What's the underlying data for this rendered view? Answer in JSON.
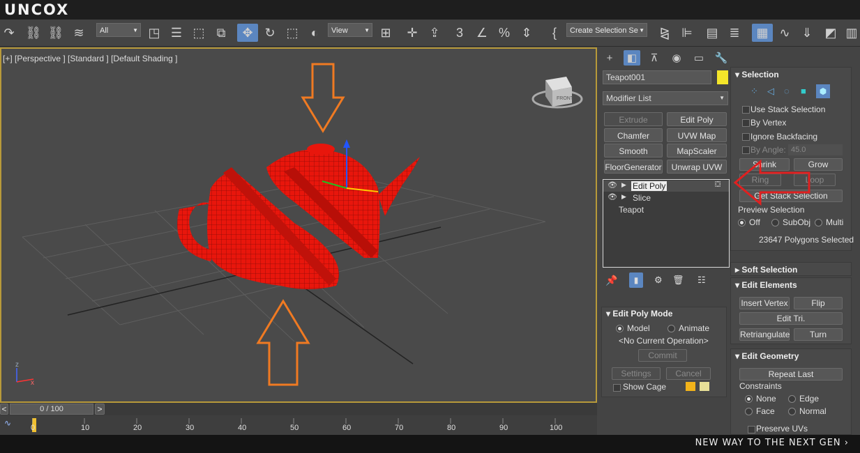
{
  "brand": "UNCOX",
  "slogan": "NEW WAY TO THE NEXT GEN ›",
  "toolbar": {
    "filter_value": "All",
    "coord_value": "View",
    "selection_set_placeholder": "Create Selection Se"
  },
  "viewport": {
    "label": "[+] [Perspective ] [Standard ] [Default Shading ]",
    "viewcube_face": "FRONT",
    "axis_x": "x",
    "axis_z": "z"
  },
  "timeline": {
    "frame_readout": "0 / 100",
    "prev": "<",
    "next": ">",
    "ticks": [
      "0",
      "10",
      "20",
      "30",
      "40",
      "50",
      "60",
      "70",
      "80",
      "90",
      "100"
    ]
  },
  "panel": {
    "object_name": "Teapot001",
    "object_color": "#f5e62a",
    "modifier_list": "Modifier List",
    "buttons": [
      "Extrude",
      "Edit Poly",
      "Chamfer",
      "UVW Map",
      "Smooth",
      "MapScaler",
      "FloorGenerator",
      "Unwrap UVW"
    ],
    "stack": [
      "Edit Poly",
      "Slice",
      "Teapot"
    ],
    "edit_poly_mode": {
      "title": "Edit Poly Mode",
      "model": "Model",
      "animate": "Animate",
      "current_op": "<No Current Operation>",
      "commit": "Commit",
      "settings": "Settings",
      "cancel": "Cancel",
      "show_cage": "Show Cage",
      "cage_color_1": "#f2b31a",
      "cage_color_2": "#e8e098"
    }
  },
  "selection": {
    "title": "Selection",
    "use_stack": "Use Stack Selection",
    "by_vertex": "By Vertex",
    "ignore_backfacing": "Ignore Backfacing",
    "by_angle": "By Angle:",
    "angle_value": "45.0",
    "shrink": "Shrink",
    "grow": "Grow",
    "ring": "Ring",
    "loop": "Loop",
    "get_stack": "Get Stack Selection",
    "preview_title": "Preview Selection",
    "off": "Off",
    "subobj": "SubObj",
    "multi": "Multi",
    "status": "23647 Polygons Selected"
  },
  "soft_selection": {
    "title": "Soft Selection"
  },
  "edit_elements": {
    "title": "Edit Elements",
    "insert_vertex": "Insert Vertex",
    "flip": "Flip",
    "edit_tri": "Edit Tri.",
    "retriangulate": "Retriangulate",
    "turn": "Turn"
  },
  "edit_geometry": {
    "title": "Edit Geometry",
    "repeat_last": "Repeat Last",
    "constraints": "Constraints",
    "none": "None",
    "edge": "Edge",
    "face": "Face",
    "normal": "Normal",
    "preserve_uvs": "Preserve UVs"
  },
  "colors": {
    "accent": "#5b86c0",
    "teapot": "#e8160c",
    "arrow_orange": "#f07a22",
    "arrow_red": "#e02020"
  }
}
